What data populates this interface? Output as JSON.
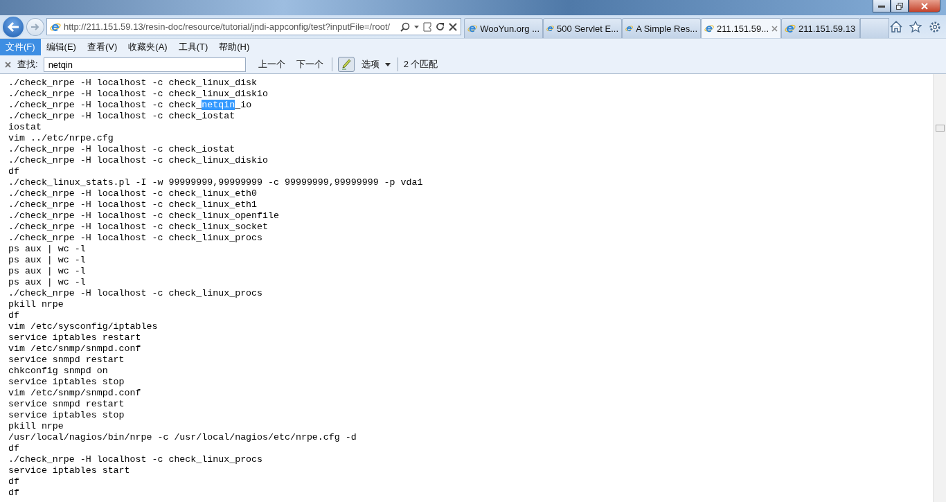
{
  "address_bar": {
    "url": "http://211.151.59.13/resin-doc/resource/tutorial/jndi-appconfig/test?inputFile=/root/"
  },
  "tabs": [
    {
      "label": "WooYun.org ...",
      "selected": false
    },
    {
      "label": "500 Servlet E...",
      "selected": false
    },
    {
      "label": "A Simple Res...",
      "selected": false
    },
    {
      "label": "211.151.59...",
      "selected": true
    },
    {
      "label": "211.151.59.13",
      "selected": false
    }
  ],
  "menu": [
    {
      "label": "文件(F)",
      "selected": true
    },
    {
      "label": "编辑(E)",
      "selected": false
    },
    {
      "label": "查看(V)",
      "selected": false
    },
    {
      "label": "收藏夹(A)",
      "selected": false
    },
    {
      "label": "工具(T)",
      "selected": false
    },
    {
      "label": "帮助(H)",
      "selected": false
    }
  ],
  "find_bar": {
    "label": "查找:",
    "value": "netqin",
    "previous": "上一个",
    "next": "下一个",
    "highlight_on": true,
    "options": "选项",
    "matches": "2 个匹配"
  },
  "lines": [
    {
      "kind": "plain",
      "text": "./check_nrpe -H localhost -c check_linux_disk"
    },
    {
      "kind": "plain",
      "text": "./check_nrpe -H localhost -c check_linux_diskio"
    },
    {
      "kind": "match",
      "before": "./check_nrpe -H localhost -c check_",
      "match": "netqin",
      "after": "_io"
    },
    {
      "kind": "plain",
      "text": "./check_nrpe -H localhost -c check_iostat"
    },
    {
      "kind": "plain",
      "text": "iostat"
    },
    {
      "kind": "plain",
      "text": "vim ../etc/nrpe.cfg"
    },
    {
      "kind": "plain",
      "text": "./check_nrpe -H localhost -c check_iostat"
    },
    {
      "kind": "plain",
      "text": "./check_nrpe -H localhost -c check_linux_diskio"
    },
    {
      "kind": "plain",
      "text": "df"
    },
    {
      "kind": "plain",
      "text": "./check_linux_stats.pl -I -w 99999999,99999999 -c 99999999,99999999 -p vda1"
    },
    {
      "kind": "plain",
      "text": "./check_nrpe -H localhost -c check_linux_eth0"
    },
    {
      "kind": "plain",
      "text": "./check_nrpe -H localhost -c check_linux_eth1"
    },
    {
      "kind": "plain",
      "text": "./check_nrpe -H localhost -c check_linux_openfile"
    },
    {
      "kind": "plain",
      "text": "./check_nrpe -H localhost -c check_linux_socket"
    },
    {
      "kind": "plain",
      "text": "./check_nrpe -H localhost -c check_linux_procs"
    },
    {
      "kind": "plain",
      "text": "ps aux | wc -l"
    },
    {
      "kind": "plain",
      "text": "ps aux | wc -l"
    },
    {
      "kind": "plain",
      "text": "ps aux | wc -l"
    },
    {
      "kind": "plain",
      "text": "ps aux | wc -l"
    },
    {
      "kind": "plain",
      "text": "./check_nrpe -H localhost -c check_linux_procs"
    },
    {
      "kind": "plain",
      "text": "pkill nrpe"
    },
    {
      "kind": "plain",
      "text": "df"
    },
    {
      "kind": "plain",
      "text": "vim /etc/sysconfig/iptables"
    },
    {
      "kind": "plain",
      "text": "service iptables restart"
    },
    {
      "kind": "plain",
      "text": "vim /etc/snmp/snmpd.conf"
    },
    {
      "kind": "plain",
      "text": "service snmpd restart"
    },
    {
      "kind": "plain",
      "text": "chkconfig snmpd on"
    },
    {
      "kind": "plain",
      "text": "service iptables stop"
    },
    {
      "kind": "plain",
      "text": "vim /etc/snmp/snmpd.conf"
    },
    {
      "kind": "plain",
      "text": "service snmpd restart"
    },
    {
      "kind": "plain",
      "text": "service iptables stop"
    },
    {
      "kind": "plain",
      "text": "pkill nrpe"
    },
    {
      "kind": "plain",
      "text": "/usr/local/nagios/bin/nrpe -c /usr/local/nagios/etc/nrpe.cfg -d"
    },
    {
      "kind": "plain",
      "text": "df"
    },
    {
      "kind": "plain",
      "text": "./check_nrpe -H localhost -c check_linux_procs"
    },
    {
      "kind": "plain",
      "text": "service iptables start"
    },
    {
      "kind": "plain",
      "text": "df"
    },
    {
      "kind": "plain",
      "text": "df"
    }
  ]
}
